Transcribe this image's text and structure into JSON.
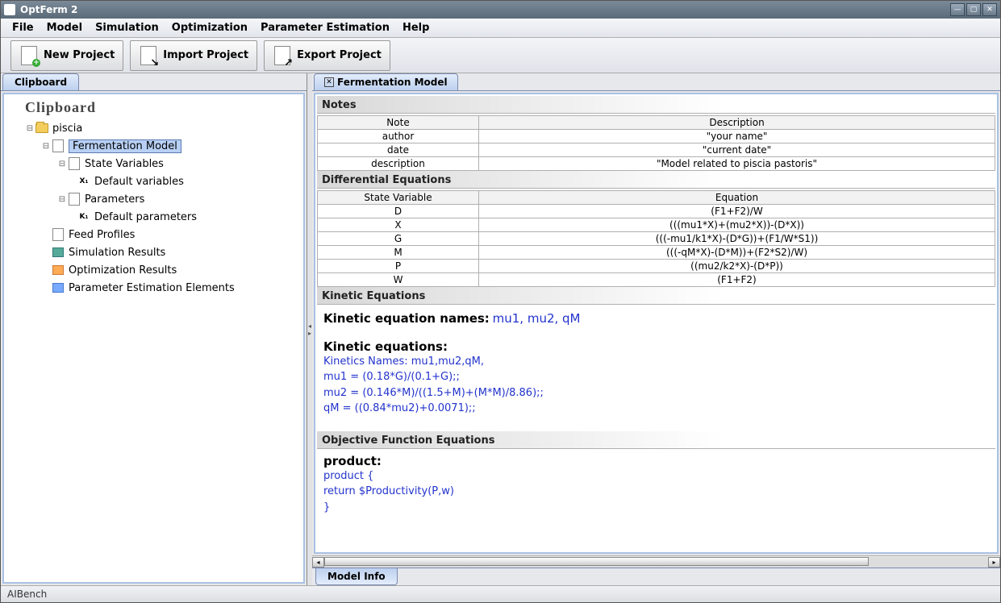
{
  "window": {
    "title": "OptFerm 2"
  },
  "menubar": [
    "File",
    "Model",
    "Simulation",
    "Optimization",
    "Parameter Estimation",
    "Help"
  ],
  "toolbar": {
    "new_project": "New Project",
    "import_project": "Import Project",
    "export_project": "Export Project"
  },
  "left": {
    "tab": "Clipboard",
    "header": "Clipboard",
    "tree": {
      "project": "piscia",
      "model": "Fermentation Model",
      "state_vars": "State Variables",
      "default_vars": "Default variables",
      "params": "Parameters",
      "default_params": "Default parameters",
      "feed": "Feed Profiles",
      "sim": "Simulation Results",
      "opt": "Optimization Results",
      "pe": "Parameter Estimation Elements"
    }
  },
  "right": {
    "tab": "Fermentation Model",
    "notes": {
      "title": "Notes",
      "cols": [
        "Note",
        "Description"
      ],
      "rows": [
        [
          "author",
          "\"your name\""
        ],
        [
          "date",
          "\"current date\""
        ],
        [
          "description",
          "\"Model related to piscia pastoris\""
        ]
      ]
    },
    "diffeq": {
      "title": "Differential Equations",
      "cols": [
        "State Variable",
        "Equation"
      ],
      "rows": [
        [
          "D",
          "(F1+F2)/W"
        ],
        [
          "X",
          "(((mu1*X)+(mu2*X))-(D*X))"
        ],
        [
          "G",
          "(((-mu1/k1*X)-(D*G))+(F1/W*S1))"
        ],
        [
          "M",
          "(((-qM*X)-(D*M))+(F2*S2)/W)"
        ],
        [
          "P",
          "((mu2/k2*X)-(D*P))"
        ],
        [
          "W",
          "(F1+F2)"
        ]
      ]
    },
    "kinetic": {
      "title": "Kinetic Equations",
      "names_label": "Kinetic equation names:",
      "names_value": "mu1, mu2, qM",
      "eq_label": "Kinetic equations:",
      "lines": [
        "Kinetics Names: mu1,mu2,qM,",
        "mu1 = (0.18*G)/(0.1+G);;",
        "mu2 = (0.146*M)/((1.5+M)+(M*M)/8.86);;",
        "qM = ((0.84*mu2)+0.0071);;"
      ]
    },
    "obj": {
      "title": "Objective Function Equations",
      "prod_label": "product:",
      "lines": [
        "product    {",
        "return $Productivity(P,w)",
        "}"
      ]
    },
    "bottom_tab": "Model Info"
  },
  "statusbar": "AIBench"
}
